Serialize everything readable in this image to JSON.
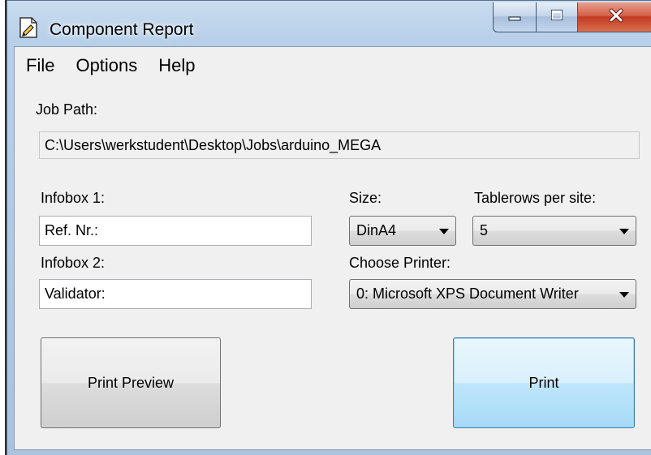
{
  "window": {
    "title": "Component Report",
    "icon": "edit-document-icon"
  },
  "menu": [
    "File",
    "Options",
    "Help"
  ],
  "job_path": {
    "label": "Job Path:",
    "value": "C:\\Users\\werkstudent\\Desktop\\Jobs\\arduino_MEGA"
  },
  "infobox1": {
    "label": "Infobox 1:",
    "value": "Ref. Nr.:"
  },
  "infobox2": {
    "label": "Infobox 2:",
    "value": "Validator:"
  },
  "size": {
    "label": "Size:",
    "value": "DinA4"
  },
  "tablerows": {
    "label": "Tablerows per site:",
    "value": "5"
  },
  "printer": {
    "label": "Choose Printer:",
    "value": "0: Microsoft XPS Document Writer"
  },
  "buttons": {
    "preview": "Print Preview",
    "print": "Print"
  },
  "colors": {
    "titlebar": "#b7cfe8",
    "client_bg": "#f0f0f0",
    "close_button": "#c23b21",
    "default_button_border": "#3c7fb1"
  }
}
